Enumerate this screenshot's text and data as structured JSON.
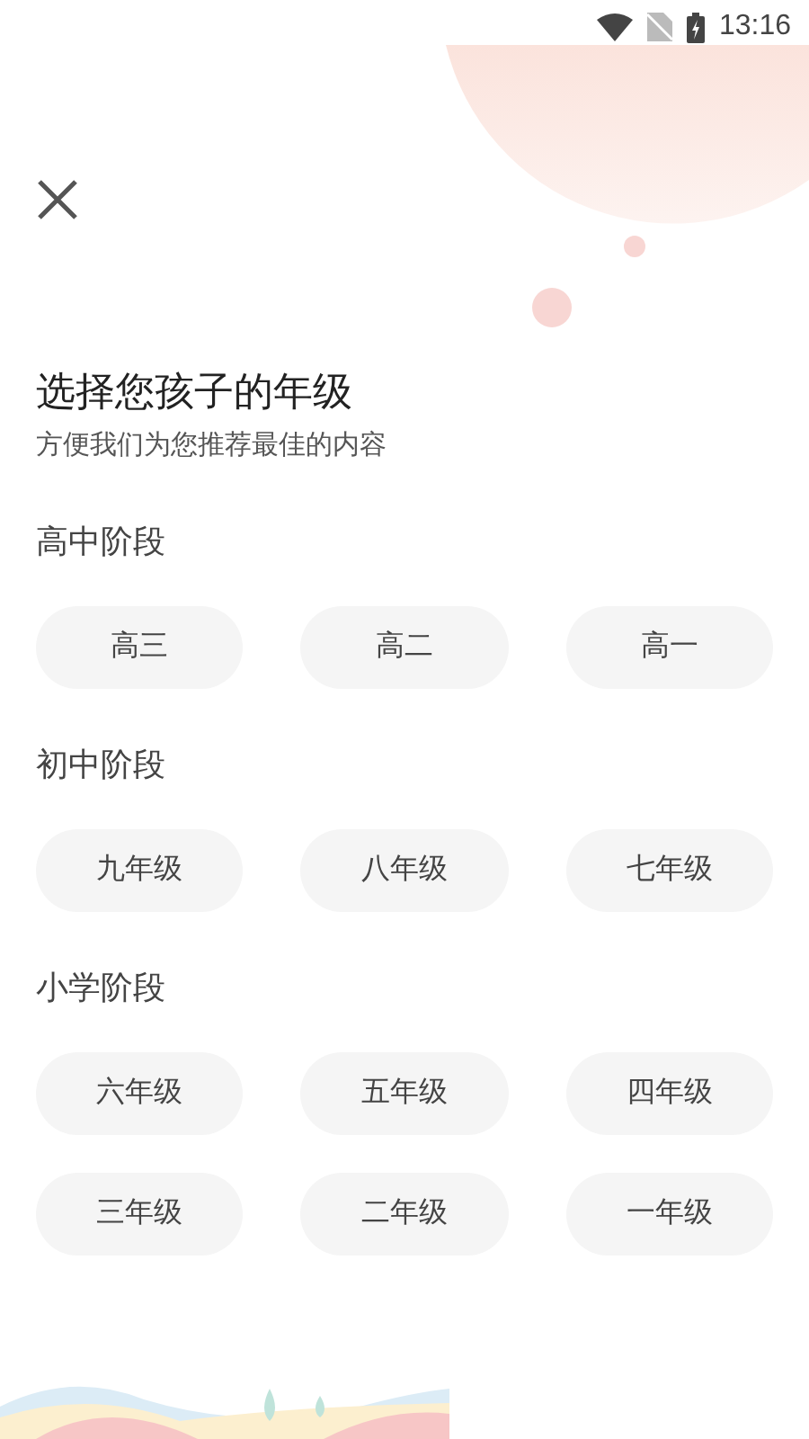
{
  "status_bar": {
    "time": "13:16"
  },
  "title": "选择您孩子的年级",
  "subtitle": "方便我们为您推荐最佳的内容",
  "sections": [
    {
      "label": "高中阶段",
      "grades": [
        {
          "label": "高三",
          "selected": false
        },
        {
          "label": "高二",
          "selected": false
        },
        {
          "label": "高一",
          "selected": false
        }
      ]
    },
    {
      "label": "初中阶段",
      "grades": [
        {
          "label": "九年级",
          "selected": false
        },
        {
          "label": "八年级",
          "selected": false
        },
        {
          "label": "七年级",
          "selected": false
        }
      ]
    },
    {
      "label": "小学阶段",
      "grades": [
        {
          "label": "六年级",
          "selected": false
        },
        {
          "label": "五年级",
          "selected": false
        },
        {
          "label": "四年级",
          "selected": false
        },
        {
          "label": "三年级",
          "selected": false
        },
        {
          "label": "二年级",
          "selected": false
        },
        {
          "label": "一年级",
          "selected": false
        }
      ]
    }
  ]
}
